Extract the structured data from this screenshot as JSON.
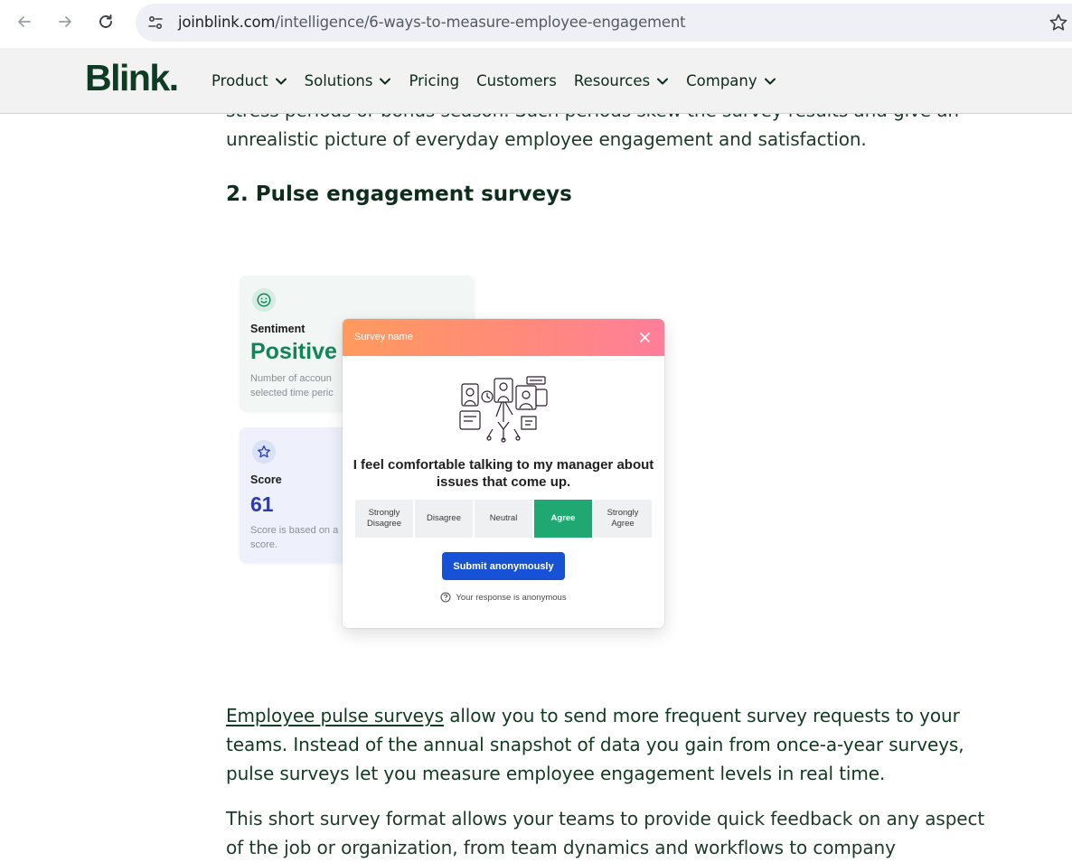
{
  "browser": {
    "url_host": "joinblink.com",
    "url_path": "/intelligence/6-ways-to-measure-employee-engagement"
  },
  "site": {
    "logo": "Blink.",
    "menu": [
      {
        "label": "Product",
        "dropdown": true
      },
      {
        "label": "Solutions",
        "dropdown": true
      },
      {
        "label": "Pricing",
        "dropdown": false
      },
      {
        "label": "Customers",
        "dropdown": false
      },
      {
        "label": "Resources",
        "dropdown": true
      },
      {
        "label": "Company",
        "dropdown": true
      }
    ]
  },
  "article": {
    "partial_line": "stress periods or bonus season. Such periods skew the survey results and give an",
    "para_top_end": "unrealistic picture of everyday employee engagement and satisfaction.",
    "heading": "2. Pulse engagement surveys",
    "pulse_link": "Employee pulse surveys",
    "pulse_rest": " allow you to send more frequent survey requests to your teams. Instead of the annual snapshot of data you gain from once-a-year surveys, pulse surveys let you measure employee engagement levels in real time.",
    "para_short": "This short survey format allows your teams to provide quick feedback on any aspect of the job or organization, from team dynamics and workflows to company"
  },
  "illustration": {
    "sentiment": {
      "label": "Sentiment",
      "value": "Positive",
      "desc_1": "Number of accoun",
      "desc_2": "selected time peric"
    },
    "score": {
      "label": "Score",
      "value": "61",
      "desc_1": "Score is based on a",
      "desc_2": "score."
    },
    "survey": {
      "title": "Survey name",
      "question": "I feel comfortable talking to my manager about issues that come up.",
      "options": [
        "Strongly Disagree",
        "Disagree",
        "Neutral",
        "Agree",
        "Strongly Agree"
      ],
      "selected": "Agree",
      "submit_label": "Submit anonymously",
      "anon_note": "Your response is anonymous"
    }
  },
  "colors": {
    "brand": "#0e3b23",
    "positive": "#12845a",
    "score": "#2b3bb0",
    "agree": "#1fa872",
    "submit": "#1752d6"
  }
}
